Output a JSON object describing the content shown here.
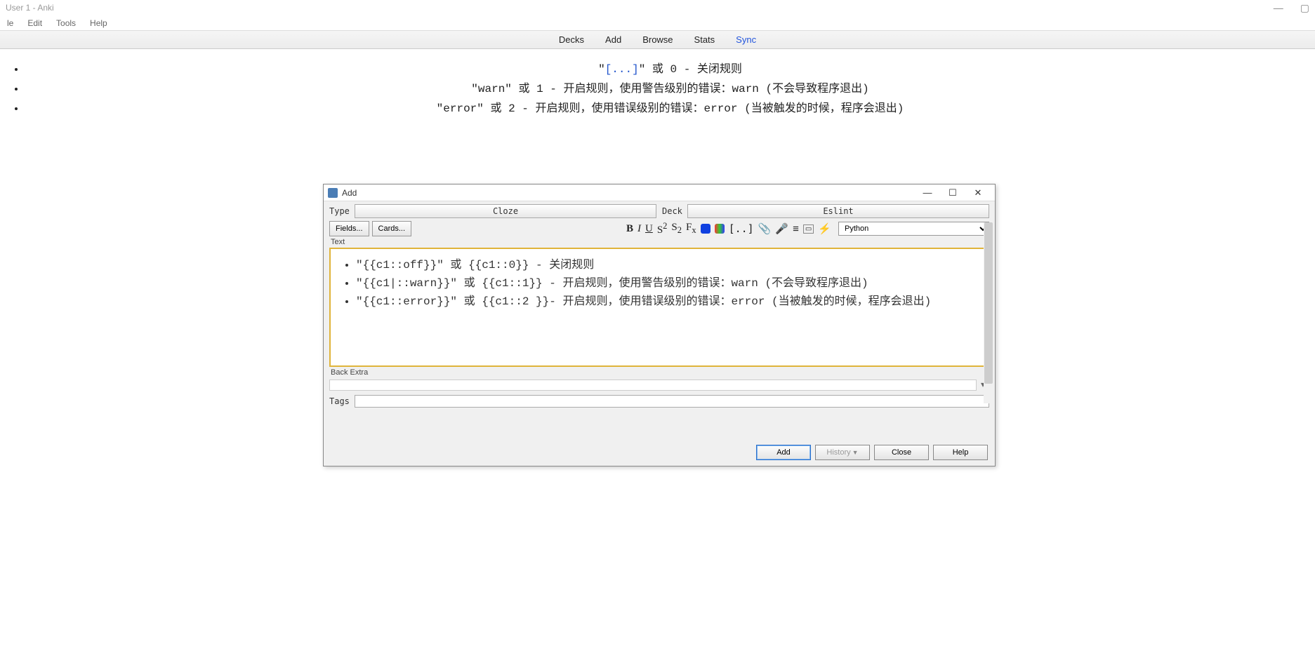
{
  "window": {
    "title": "User 1 - Anki",
    "menus": [
      "le",
      "Edit",
      "Tools",
      "Help"
    ]
  },
  "toolbar": {
    "items": [
      "Decks",
      "Add",
      "Browse",
      "Stats"
    ],
    "sync": "Sync"
  },
  "main": {
    "line1_pre": "\"",
    "line1_cloze": "[...]",
    "line1_post": "\" 或 0 - 关闭规则",
    "line2": "\"warn\" 或 1 - 开启规则，使用警告级别的错误：warn (不会导致程序退出)",
    "line3": "\"error\" 或 2 - 开启规则，使用错误级别的错误：error (当被触发的时候，程序会退出)"
  },
  "dialog": {
    "title": "Add",
    "type_label": "Type",
    "type_value": "Cloze",
    "deck_label": "Deck",
    "deck_value": "Eslint",
    "fields_btn": "Fields...",
    "cards_btn": "Cards...",
    "lang": "Python",
    "text_label": "Text",
    "bullets": [
      "\"{{c1::off}}\" 或 {{c1::0}} - 关闭规则",
      "\"{{c1|::warn}}\" 或 {{c1::1}} - 开启规则，使用警告级别的错误：warn (不会导致程序退出)",
      "\"{{c1::error}}\" 或 {{c1::2 }}- 开启规则，使用错误级别的错误：error (当被触发的时候，程序会退出)"
    ],
    "back_extra_label": "Back Extra",
    "tags_label": "Tags",
    "add_btn": "Add",
    "history_btn": "History",
    "close_btn": "Close",
    "help_btn": "Help"
  }
}
